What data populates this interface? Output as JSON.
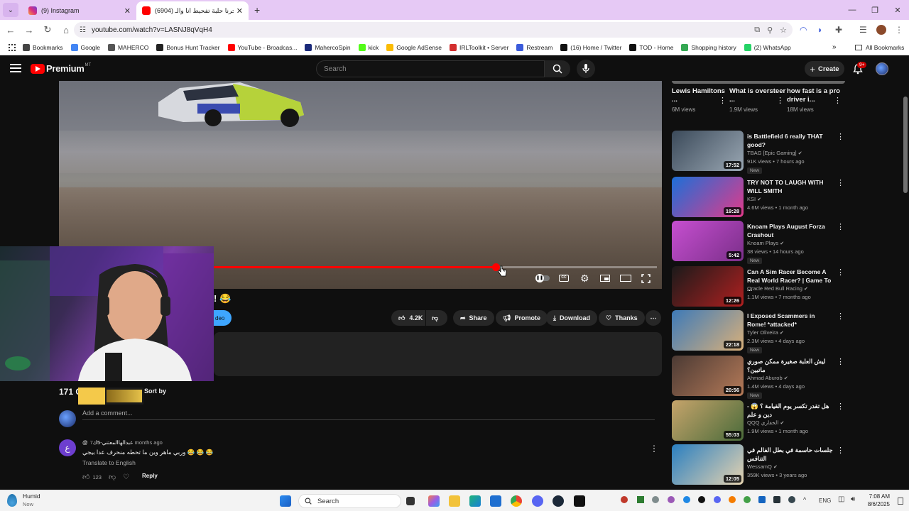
{
  "browser": {
    "tabs": [
      {
        "title": "(9) Instagram"
      },
      {
        "title": "(6904) استأجرنا حلبة تفحيط انا والـ"
      }
    ],
    "url": "youtube.com/watch?v=LASNJ8qVqH4",
    "bookmarks": [
      {
        "label": "Bookmarks",
        "color": "#444"
      },
      {
        "label": "Google",
        "color": "#4285f4"
      },
      {
        "label": "MAHERCO",
        "color": "#555"
      },
      {
        "label": "Bonus Hunt Tracker",
        "color": "#222"
      },
      {
        "label": "YouTube - Broadcas...",
        "color": "#ff0000"
      },
      {
        "label": "MahercoSpin",
        "color": "#1b2a7a"
      },
      {
        "label": "kick",
        "color": "#53fc18"
      },
      {
        "label": "Google AdSense",
        "color": "#fbbc04"
      },
      {
        "label": "IRLToolkit • Server",
        "color": "#d32f2f"
      },
      {
        "label": "Restream",
        "color": "#3b5bdb"
      },
      {
        "label": "(16) Home / Twitter",
        "color": "#111"
      },
      {
        "label": "TOD - Home",
        "color": "#111"
      },
      {
        "label": "Shopping history",
        "color": "#34a853"
      },
      {
        "label": "(2) WhatsApp",
        "color": "#25d366"
      }
    ],
    "all_bookmarks": "All Bookmarks"
  },
  "youtube": {
    "logo_text": "Premium",
    "logo_badge": "MT",
    "search_placeholder": "Search",
    "create_label": "Create",
    "notif_count": "9+"
  },
  "player": {
    "progress_fraction": 0.73
  },
  "video": {
    "title_visible": "! 😂",
    "sub_fragment": "deo",
    "likes": "4.2K",
    "share": "Share",
    "promote": "Promote",
    "download": "Download",
    "thanks": "Thanks"
  },
  "comments": {
    "count": "171 C",
    "sort_by": "Sort by",
    "add_placeholder": "Add a comment...",
    "items": [
      {
        "avatar_letter": "ع",
        "author": "@عبدالهاالمعتني-5ك",
        "time": "7 months ago",
        "text": "وربي ماهر وين ما تحطه منحرف عدا بيجي 😂 😂 😂",
        "translate": "Translate to English",
        "likes": "123",
        "reply": "Reply"
      }
    ]
  },
  "shorts": [
    {
      "title": "Lewis Hamiltons ...",
      "views": "6M views"
    },
    {
      "title": "What is oversteer ...",
      "views": "1.9M views"
    },
    {
      "title": "how fast is a pro driver i...",
      "views": "18M views"
    }
  ],
  "recommendations": [
    {
      "title": "is Battlefield 6 really THAT good?",
      "channel": "TBAG [Epic Gaming]",
      "meta": "91K views • 7 hours ago",
      "duration": "17:52",
      "new": "New",
      "colors": [
        "#3b4a5a",
        "#9aa7b3"
      ]
    },
    {
      "title": "TRY NOT TO LAUGH WITH WILL SMITH",
      "channel": "KSI",
      "meta": "4.6M views • 1 month ago",
      "duration": "19:28",
      "new": "",
      "colors": [
        "#1c6fd8",
        "#e23a8a"
      ]
    },
    {
      "title": "Knoam Plays August Forza Crashout",
      "channel": "Knoam Plays",
      "meta": "38 views • 14 hours ago",
      "duration": "5:42",
      "new": "New",
      "colors": [
        "#c64fd0",
        "#7b2f8a"
      ]
    },
    {
      "title": "Can A Sim Racer Become A Real World Racer? | Game To ...",
      "channel": "Oracle Red Bull Racing",
      "meta": "1.1M views • 7 months ago",
      "duration": "12:26",
      "new": "",
      "colors": [
        "#1a1a1a",
        "#b02020"
      ]
    },
    {
      "title": "I Exposed Scammers in Rome! *attacked*",
      "channel": "Tyler Oliveira",
      "meta": "2.3M views • 4 days ago",
      "duration": "22:18",
      "new": "New",
      "colors": [
        "#3d7ab8",
        "#d9b07a"
      ]
    },
    {
      "title": "ليش العلبة صغيرة ممكن صوري ماتبين؟",
      "channel": "Ahmad Aburob",
      "meta": "1.4M views • 4 days ago",
      "duration": "20:56",
      "new": "New",
      "colors": [
        "#4b3a34",
        "#b57a58"
      ]
    },
    {
      "title": "هل تقدر تكسر يوم القيامة ؟ 😱 - دين و علم",
      "channel": "QQQ الخفاري",
      "meta": "1.9M views • 1 month ago",
      "duration": "55:03",
      "new": "",
      "colors": [
        "#c6a46b",
        "#4a6b3a"
      ]
    },
    {
      "title": "جلسات حاسمة في بطل الفالم في التنافس",
      "channel": "WessamQ",
      "meta": "359K views • 3 years ago",
      "duration": "12:05",
      "new": "",
      "colors": [
        "#2a7fc0",
        "#e6d3b0"
      ]
    }
  ],
  "taskbar": {
    "weather_title": "Humid",
    "weather_sub": "Now",
    "search": "Search",
    "lang": "ENG",
    "time": "7:08 AM",
    "date": "8/6/2025"
  }
}
